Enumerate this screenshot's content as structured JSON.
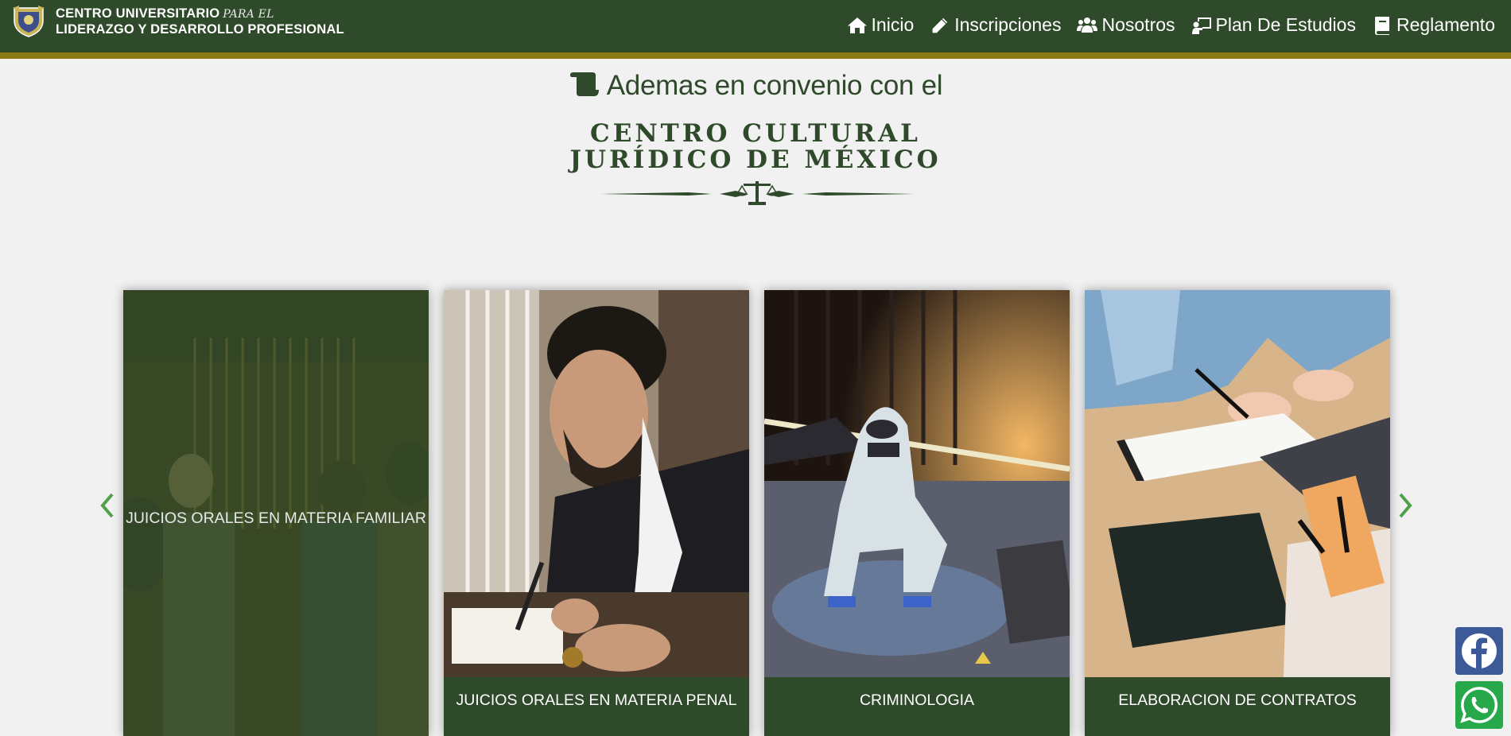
{
  "header": {
    "brand_line1": "CENTRO UNIVERSITARIO",
    "brand_script": "PARA EL",
    "brand_line2": "LIDERAZGO Y DESARROLLO PROFESIONAL",
    "nav": [
      {
        "label": "Inicio",
        "icon": "home-icon"
      },
      {
        "label": "Inscripciones",
        "icon": "pencil-icon"
      },
      {
        "label": "Nosotros",
        "icon": "users-icon"
      },
      {
        "label": "Plan De Estudios",
        "icon": "chalkboard-teacher-icon"
      },
      {
        "label": "Reglamento",
        "icon": "book-icon"
      }
    ]
  },
  "convenio": {
    "title": "Ademas en convenio con el",
    "icon": "scroll-icon",
    "partner_name": "CENTRO CULTURAL\nJURÍDICO DE MÉXICO"
  },
  "carousel": {
    "cards": [
      {
        "caption": "JUICIOS ORALES EN MATERIA FAMILIAR",
        "hovered": true
      },
      {
        "caption": "JUICIOS ORALES EN MATERIA PENAL",
        "hovered": false
      },
      {
        "caption": "CRIMINOLOGIA",
        "hovered": false
      },
      {
        "caption": "ELABORACION DE CONTRATOS",
        "hovered": false
      }
    ]
  },
  "colors": {
    "primary": "#2f4a2a",
    "accent_gold": "#8e7a14",
    "arrow_green": "#4fa04a",
    "facebook": "#3c5a98",
    "whatsapp": "#27a84a"
  }
}
